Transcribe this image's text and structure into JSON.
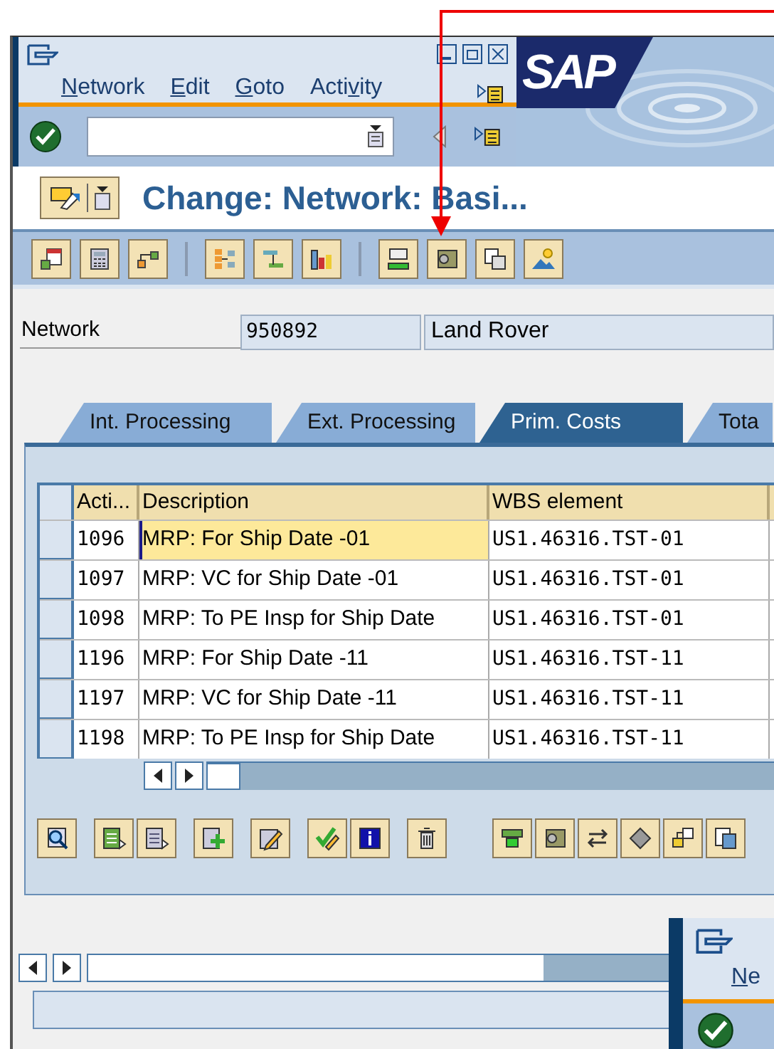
{
  "window": {
    "logo": "SAP",
    "menu": [
      {
        "key": "N",
        "post": "etwork"
      },
      {
        "key": "E",
        "post": "dit"
      },
      {
        "key": "G",
        "post": "oto"
      },
      {
        "pre": "Acti",
        "key": "v",
        "post": "ity"
      }
    ]
  },
  "title": "Change: Network: Basi...",
  "header": {
    "label": "Network",
    "number": "950892",
    "description": "Land Rover"
  },
  "tabs": [
    {
      "label": "Int. Processing",
      "selected": false
    },
    {
      "label": "Ext. Processing",
      "selected": false
    },
    {
      "label": "Prim. Costs",
      "selected": true
    },
    {
      "label": "Tota",
      "selected": false
    }
  ],
  "table": {
    "columns": [
      "Acti...",
      "Description",
      "WBS element"
    ],
    "rows": [
      {
        "activity": "1096",
        "description": "MRP: For Ship Date -01",
        "wbs": "US1.46316.TST-01",
        "current": true
      },
      {
        "activity": "1097",
        "description": "MRP: VC for Ship Date -01",
        "wbs": "US1.46316.TST-01",
        "current": false
      },
      {
        "activity": "1098",
        "description": "MRP: To PE Insp for Ship Date",
        "wbs": "US1.46316.TST-01",
        "current": false
      },
      {
        "activity": "1196",
        "description": "MRP: For Ship Date -11",
        "wbs": "US1.46316.TST-11",
        "current": false
      },
      {
        "activity": "1197",
        "description": "MRP: VC for Ship Date -11",
        "wbs": "US1.46316.TST-11",
        "current": false
      },
      {
        "activity": "1198",
        "description": "MRP: To PE Insp for Ship Date",
        "wbs": "US1.46316.TST-11",
        "current": false
      }
    ]
  },
  "second_window": {
    "menu": [
      {
        "key": "N",
        "post": "e"
      }
    ]
  }
}
